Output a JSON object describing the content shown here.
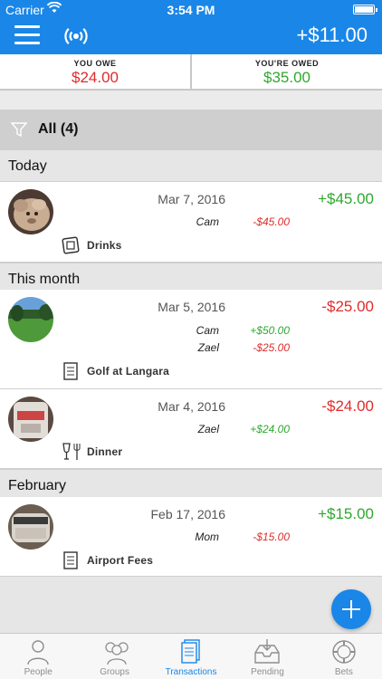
{
  "status_bar": {
    "carrier": "Carrier",
    "time": "3:54 PM"
  },
  "nav": {
    "balance": "+$11.00",
    "menu_icon": "menu-icon",
    "sync_icon": "broadcast-icon"
  },
  "summary": {
    "you_owe": {
      "label": "YOU OWE",
      "value": "$24.00"
    },
    "youre_owed": {
      "label": "YOU'RE OWED",
      "value": "$35.00"
    }
  },
  "filter": {
    "label": "All (4)",
    "icon": "filter-icon"
  },
  "sections": [
    {
      "title": "Today"
    },
    {
      "title": "This month"
    },
    {
      "title": "February"
    }
  ],
  "transactions": [
    {
      "date": "Mar 7, 2016",
      "amount": "+$45.00",
      "shares": [
        {
          "name": "Cam",
          "amount": "-$45.00"
        }
      ],
      "description": "Drinks",
      "category_icon": "receipt-icon"
    },
    {
      "date": "Mar 5, 2016",
      "amount": "-$25.00",
      "shares": [
        {
          "name": "Cam",
          "amount": "+$50.00"
        },
        {
          "name": "Zael",
          "amount": "-$25.00"
        }
      ],
      "description": "Golf at Langara",
      "category_icon": "document-icon"
    },
    {
      "date": "Mar 4, 2016",
      "amount": "-$24.00",
      "shares": [
        {
          "name": "Zael",
          "amount": "+$24.00"
        }
      ],
      "description": "Dinner",
      "category_icon": "dining-icon"
    },
    {
      "date": "Feb 17, 2016",
      "amount": "+$15.00",
      "shares": [
        {
          "name": "Mom",
          "amount": "-$15.00"
        }
      ],
      "description": "Airport Fees",
      "category_icon": "document-icon"
    }
  ],
  "tabs": [
    {
      "label": "People",
      "icon": "person-icon"
    },
    {
      "label": "Groups",
      "icon": "group-icon"
    },
    {
      "label": "Transactions",
      "icon": "transactions-icon",
      "active": true
    },
    {
      "label": "Pending",
      "icon": "inbox-icon"
    },
    {
      "label": "Bets",
      "icon": "chip-icon"
    }
  ],
  "colors": {
    "accent": "#1a86e8",
    "negative": "#e02b2b",
    "positive": "#2ea82e"
  }
}
